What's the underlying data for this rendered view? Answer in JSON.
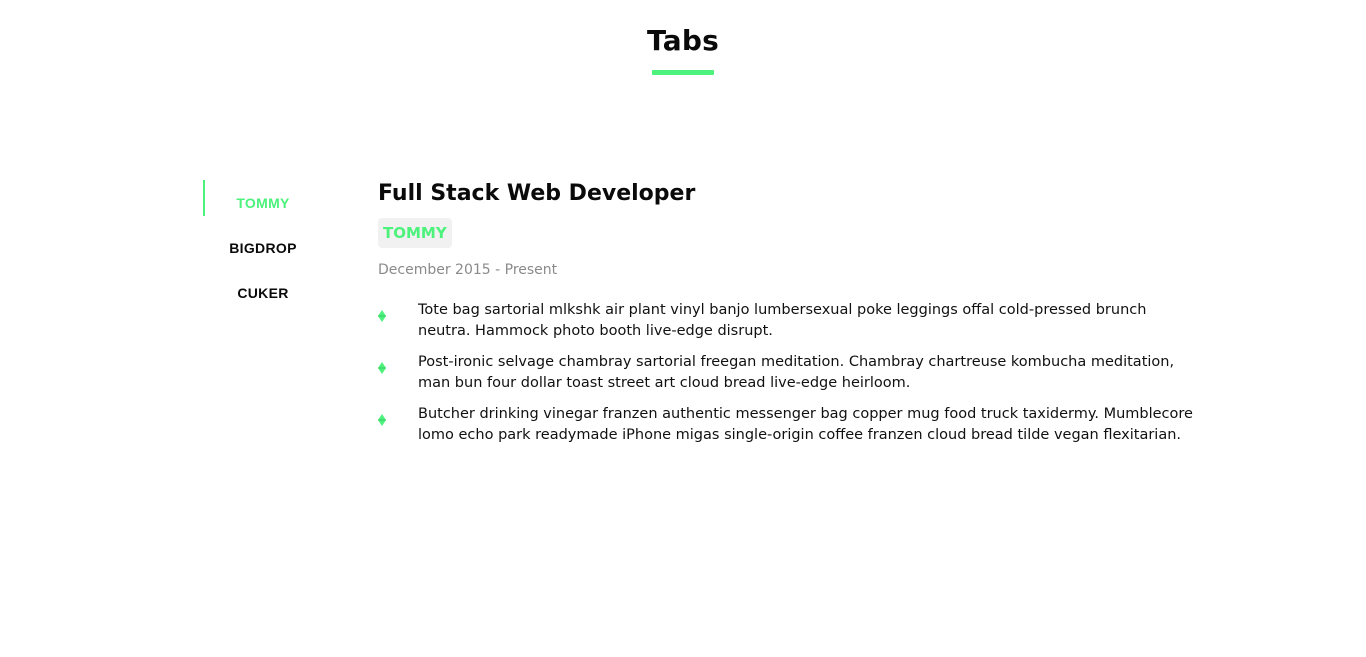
{
  "section": {
    "title": "Tabs"
  },
  "colors": {
    "accent": "#4cf27c",
    "badge_bg": "#f1f1f1",
    "muted_text": "#8a8a8a"
  },
  "tabs": [
    {
      "label": "TOMMY",
      "active": true
    },
    {
      "label": "BIGDROP",
      "active": false
    },
    {
      "label": "CUKER",
      "active": false
    }
  ],
  "panel": {
    "job_title": "Full Stack Web Developer",
    "company": "TOMMY",
    "date_range": "December 2015 - Present",
    "bullet_icon": "diamond-icon",
    "bullets": [
      "Tote bag sartorial mlkshk air plant vinyl banjo lumbersexual poke leggings offal cold-pressed brunch neutra. Hammock photo booth live-edge disrupt.",
      "Post-ironic selvage chambray sartorial freegan meditation. Chambray chartreuse kombucha meditation, man bun four dollar toast street art cloud bread live-edge heirloom.",
      "Butcher drinking vinegar franzen authentic messenger bag copper mug food truck taxidermy. Mumblecore lomo echo park readymade iPhone migas single-origin coffee franzen cloud bread tilde vegan flexitarian."
    ]
  }
}
